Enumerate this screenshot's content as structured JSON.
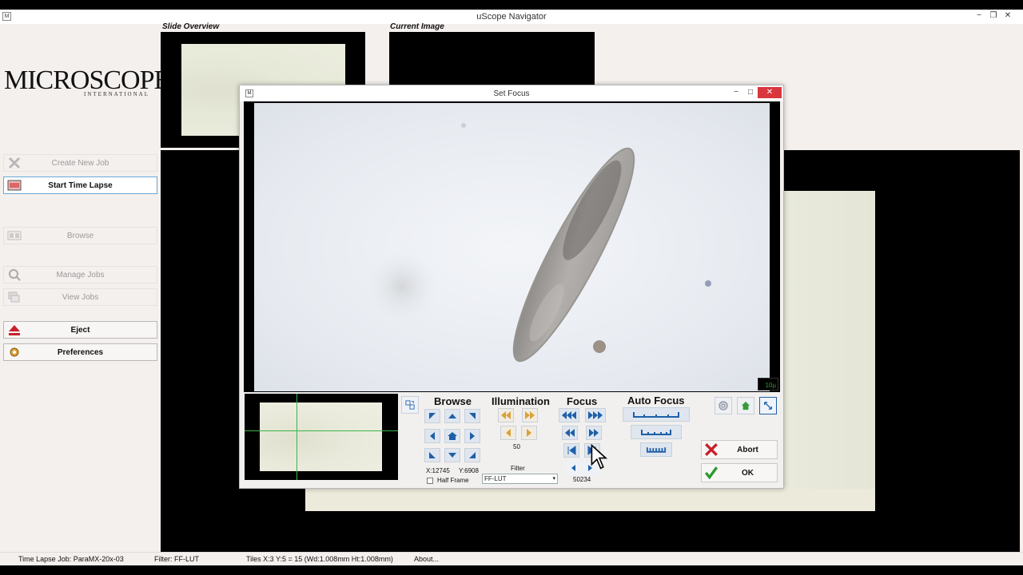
{
  "window": {
    "title": "uScope Navigator",
    "icon": "app-icon",
    "min": "−",
    "restore": "❐",
    "close": "✕"
  },
  "logo": {
    "main": "MICROSCOPES",
    "sub": "INTERNATIONAL"
  },
  "sidebar": {
    "items": [
      {
        "label": "Create New Job",
        "icon": "star-icon",
        "state": "disabled"
      },
      {
        "label": "Start Time Lapse",
        "icon": "film-icon",
        "state": "highlight"
      },
      {
        "label": "Browse",
        "icon": "browse-icon",
        "state": "disabled"
      },
      {
        "label": "Manage Jobs",
        "icon": "magnifier-icon",
        "state": "disabled"
      },
      {
        "label": "View Jobs",
        "icon": "stack-icon",
        "state": "disabled"
      },
      {
        "label": "Eject",
        "icon": "eject-icon",
        "state": "active"
      },
      {
        "label": "Preferences",
        "icon": "gear-icon",
        "state": "active"
      }
    ]
  },
  "panels": {
    "slide_overview": "Slide Overview",
    "current_image": "Current Image"
  },
  "dialog": {
    "title": "Set Focus",
    "scale_bar": "10µ",
    "browse": {
      "label": "Browse",
      "coord_x": "X:12745",
      "coord_y": "Y:6908",
      "half_frame": "Half Frame"
    },
    "illumination": {
      "label": "Illumination",
      "value": "50"
    },
    "filter": {
      "label": "Filter",
      "value": "FF-LUT"
    },
    "focus": {
      "label": "Focus",
      "value": "50234"
    },
    "auto_focus": {
      "label": "Auto Focus"
    },
    "abort": "Abort",
    "ok": "OK"
  },
  "status": {
    "job": "Time Lapse Job: ParaMX-20x-03",
    "filter": "Filter: FF-LUT",
    "tiles": "Tiles X:3 Y:5 = 15 (Wd:1.008mm Ht:1.008mm)",
    "about": "About..."
  },
  "colors": {
    "accent_blue": "#1f5fa8",
    "arrow_gold": "#d9a23a",
    "close_red": "#d9363e"
  }
}
